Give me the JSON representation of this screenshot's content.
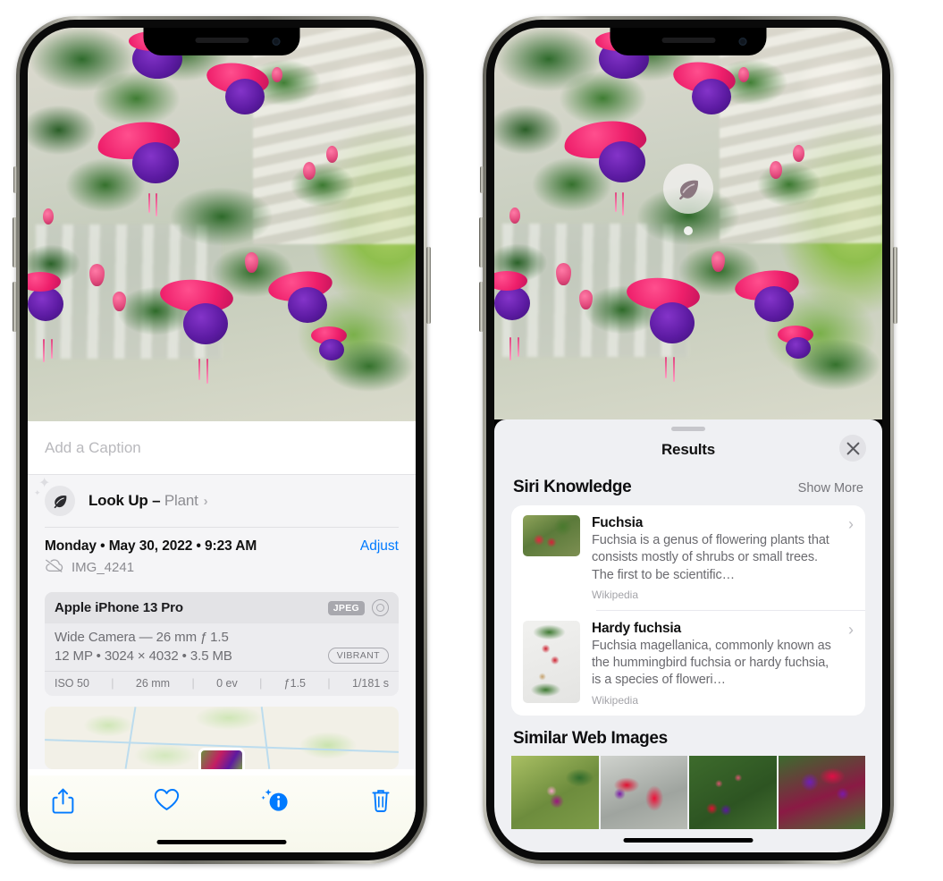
{
  "left_phone": {
    "photo": {
      "alt_name": "fuchsia-flowers-photo"
    },
    "caption_placeholder": "Add a Caption",
    "lookup": {
      "icon": "leaf-icon",
      "label": "Look Up – ",
      "subject": "Plant",
      "chevron": "›"
    },
    "meta": {
      "date": "Monday • May 30, 2022 • 9:23 AM",
      "adjust": "Adjust",
      "cloud_icon": "cloud-slash-icon",
      "filename": "IMG_4241"
    },
    "camera_card": {
      "device": "Apple iPhone 13 Pro",
      "format_badge": "JPEG",
      "aperture_icon": "aperture-icon",
      "lens": "Wide Camera — 26 mm ƒ 1.5",
      "size_line": "12 MP • 3024 × 4032 • 3.5 MB",
      "profile_badge": "VIBRANT",
      "exif": [
        "ISO 50",
        "26 mm",
        "0 ev",
        "ƒ1.5",
        "1/181 s"
      ]
    },
    "map": {
      "name": "location-map-thumbnail"
    },
    "toolbar": {
      "share": "share-icon",
      "favorite": "heart-icon",
      "info": "info-sparkle-icon",
      "delete": "trash-icon"
    }
  },
  "right_phone": {
    "photo_badge": {
      "icon": "leaf-icon",
      "name": "visual-lookup-leaf-badge"
    },
    "sheet": {
      "title": "Results",
      "close": "✕"
    },
    "siri_knowledge": {
      "title": "Siri Knowledge",
      "action": "Show More",
      "items": [
        {
          "title": "Fuchsia",
          "description": "Fuchsia is a genus of flowering plants that consists mostly of shrubs or small trees. The first to be scientific…",
          "source": "Wikipedia",
          "chevron": "›"
        },
        {
          "title": "Hardy fuchsia",
          "description": "Fuchsia magellanica, commonly known as the hummingbird fuchsia or hardy fuchsia, is a species of floweri…",
          "source": "Wikipedia",
          "chevron": "›"
        }
      ]
    },
    "similar_web_images": {
      "title": "Similar Web Images",
      "thumbs": [
        "web-image-1",
        "web-image-2",
        "web-image-3",
        "web-image-4"
      ]
    }
  }
}
